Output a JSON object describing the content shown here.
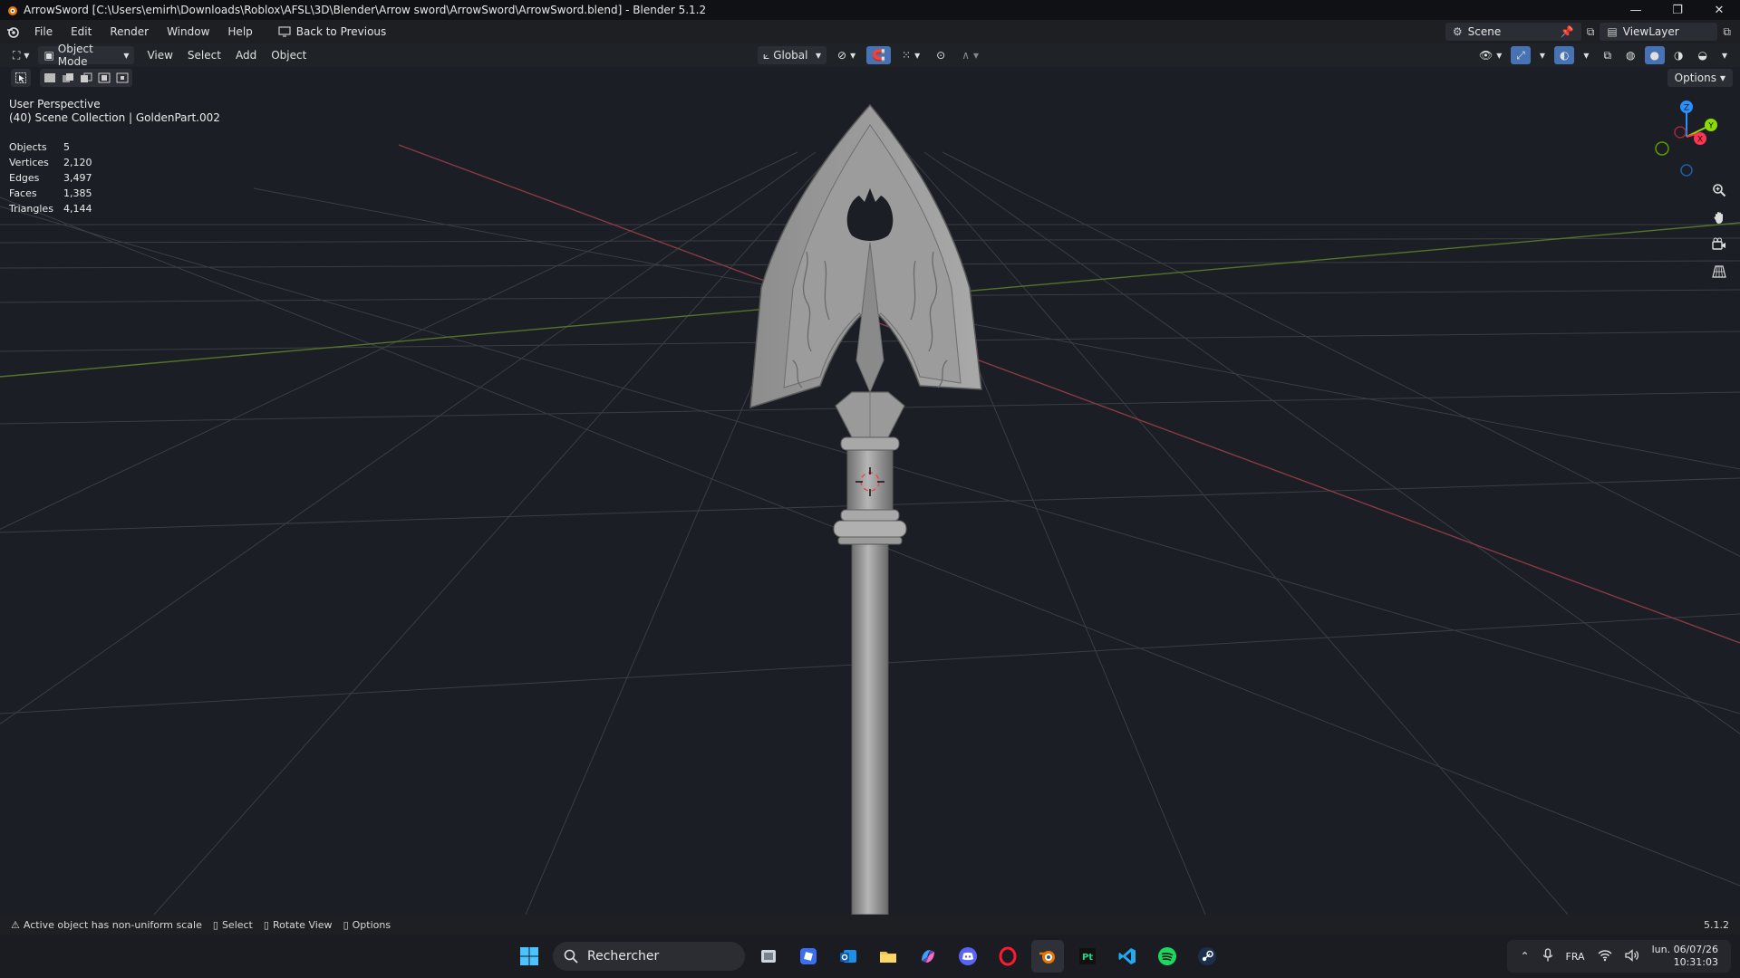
{
  "window": {
    "title": "ArrowSword [C:\\Users\\emirh\\Downloads\\Roblox\\AFSL\\3D\\Blender\\Arrow sword\\ArrowSword\\ArrowSword.blend] - Blender 5.1.2"
  },
  "menubar": {
    "items": [
      "File",
      "Edit",
      "Render",
      "Window",
      "Help"
    ],
    "back_label": "Back to Previous",
    "scene_label": "Scene",
    "viewlayer_label": "ViewLayer"
  },
  "viewport_header": {
    "mode_label": "Object Mode",
    "menus": [
      "View",
      "Select",
      "Add",
      "Object"
    ],
    "transform_orientation": "Global"
  },
  "toolrow": {
    "options_label": "Options"
  },
  "viewport": {
    "perspective_label": "User Perspective",
    "collection_label": "(40) Scene Collection | GoldenPart.002",
    "stats": [
      {
        "label": "Objects",
        "value": "5"
      },
      {
        "label": "Vertices",
        "value": "2,120"
      },
      {
        "label": "Edges",
        "value": "3,497"
      },
      {
        "label": "Faces",
        "value": "1,385"
      },
      {
        "label": "Triangles",
        "value": "4,144"
      }
    ],
    "gizmo_axes": {
      "z": "Z",
      "y": "Y",
      "x": "X"
    }
  },
  "statusbar": {
    "warning": "Active object has non-uniform scale",
    "select": "Select",
    "rotate": "Rotate View",
    "options": "Options",
    "version": "5.1.2"
  },
  "taskbar": {
    "search_placeholder": "Rechercher",
    "language": "FRA",
    "date": "lun. 06/07/26",
    "time": "10:31:03"
  },
  "colors": {
    "accent": "#4772b3",
    "x_axis": "#ff3352",
    "y_axis": "#8bdc00",
    "z_axis": "#2890ff"
  }
}
